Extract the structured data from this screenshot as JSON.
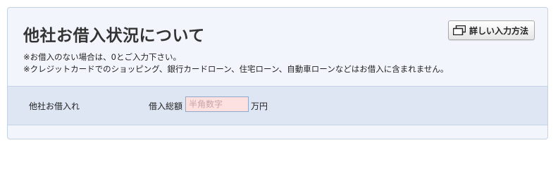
{
  "section": {
    "title": "他社お借入状況について",
    "detail_button": {
      "label": "詳しい入力方法",
      "icon": "overlapping-windows-icon"
    },
    "notes": [
      "※お借入のない場合は、0とご入力下さい。",
      "※クレジットカードでのショッピング、銀行カードローン、住宅ローン、自動車ローンなどはお借入に含まれません。"
    ]
  },
  "form": {
    "row_label": "他社お借入れ",
    "amount_label": "借入総額",
    "amount_value": "",
    "amount_placeholder": "半角数字",
    "amount_unit": "万円"
  },
  "colors": {
    "panel_bg": "#f2f6fc",
    "row_bg": "#dee6f3",
    "input_bg": "#fde0e0"
  }
}
